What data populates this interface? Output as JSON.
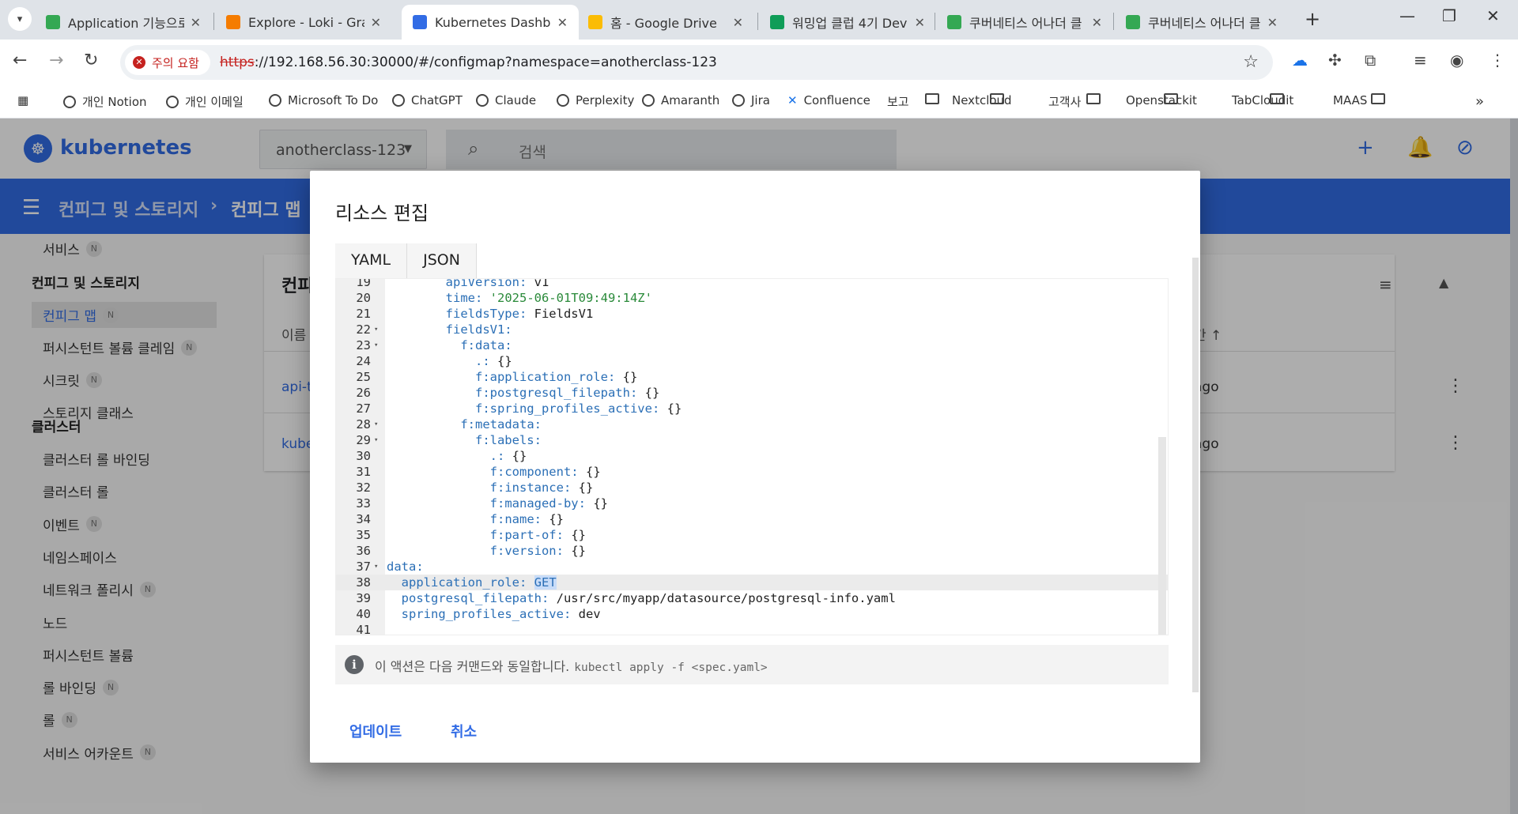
{
  "browser": {
    "tabs": [
      {
        "label": "Application 기능으로",
        "color": "#34a853"
      },
      {
        "label": "Explore - Loki - Graf",
        "color": "#f57c00"
      },
      {
        "label": "Kubernetes Dashboard",
        "color": "#326ce5"
      },
      {
        "label": "홈 - Google Drive",
        "color": "#fbbc04"
      },
      {
        "label": "워밍업 클럽 4기 Dev",
        "color": "#0f9d58"
      },
      {
        "label": "쿠버네티스 어나더 클",
        "color": "#34a853"
      },
      {
        "label": "쿠버네티스 어나더 클",
        "color": "#34a853"
      }
    ],
    "security_chip": "주의 요함",
    "url_scheme": "https",
    "url_rest": "://192.168.56.30:30000/#/configmap?namespace=anotherclass-123",
    "bookmarks": [
      {
        "label": "개인 Notion",
        "kind": "globe"
      },
      {
        "label": "개인 이메일",
        "kind": "globe"
      },
      {
        "label": "Microsoft To Do",
        "kind": "globe"
      },
      {
        "label": "ChatGPT",
        "kind": "globe"
      },
      {
        "label": "Claude",
        "kind": "globe"
      },
      {
        "label": "Perplexity",
        "kind": "globe"
      },
      {
        "label": "Amaranth",
        "kind": "globe"
      },
      {
        "label": "Jira",
        "kind": "globe"
      },
      {
        "label": "Confluence",
        "kind": "confluence"
      },
      {
        "label": "보고",
        "kind": "folder"
      },
      {
        "label": "Nextcloud",
        "kind": "folder"
      },
      {
        "label": "고객사",
        "kind": "folder"
      },
      {
        "label": "Openstackit",
        "kind": "folder"
      },
      {
        "label": "TabCloudit",
        "kind": "folder"
      },
      {
        "label": "MAAS",
        "kind": "folder"
      }
    ]
  },
  "app": {
    "brand": "kubernetes",
    "namespace": "anotherclass-123",
    "search_placeholder": "검색",
    "breadcrumb": [
      "컨피그 및 스토리지",
      "컨피그 맵"
    ],
    "sidebar": {
      "top_item": "서비스",
      "section_config": "컨피그 및 스토리지",
      "config_items": [
        {
          "label": "컨피그 맵",
          "badge": "N",
          "selected": true
        },
        {
          "label": "퍼시스턴트 볼륨 클레임",
          "badge": "N"
        },
        {
          "label": "시크릿",
          "badge": "N"
        },
        {
          "label": "스토리지 클래스",
          "badge": ""
        }
      ],
      "section_cluster": "클러스터",
      "cluster_items": [
        {
          "label": "클러스터 롤 바인딩",
          "badge": ""
        },
        {
          "label": "클러스터 롤",
          "badge": ""
        },
        {
          "label": "이벤트",
          "badge": "N"
        },
        {
          "label": "네임스페이스",
          "badge": ""
        },
        {
          "label": "네트워크 폴리시",
          "badge": "N"
        },
        {
          "label": "노드",
          "badge": ""
        },
        {
          "label": "퍼시스턴트 볼륨",
          "badge": ""
        },
        {
          "label": "롤 바인딩",
          "badge": "N"
        },
        {
          "label": "롤",
          "badge": "N"
        },
        {
          "label": "서비스 어카운트",
          "badge": "N"
        }
      ]
    },
    "card": {
      "title": "컨피",
      "col_name": "이름",
      "col_time": "간",
      "rows": [
        {
          "name": "api-te",
          "age": "ago"
        },
        {
          "name": "kube",
          "age": "ago"
        }
      ]
    }
  },
  "modal": {
    "title": "리소스 편집",
    "tabs": [
      "YAML",
      "JSON"
    ],
    "lines": [
      {
        "n": "19",
        "fold": false,
        "indent": "        ",
        "segments": [
          {
            "t": "apiVersion: ",
            "c": "k"
          },
          {
            "t": "v1",
            "c": "v"
          }
        ]
      },
      {
        "n": "20",
        "fold": false,
        "indent": "        ",
        "segments": [
          {
            "t": "time: ",
            "c": "k"
          },
          {
            "t": "'2025-06-01T09:49:14Z'",
            "c": "s"
          }
        ]
      },
      {
        "n": "21",
        "fold": false,
        "indent": "        ",
        "segments": [
          {
            "t": "fieldsType: ",
            "c": "k"
          },
          {
            "t": "FieldsV1",
            "c": "v"
          }
        ]
      },
      {
        "n": "22",
        "fold": true,
        "indent": "        ",
        "segments": [
          {
            "t": "fieldsV1:",
            "c": "k"
          }
        ]
      },
      {
        "n": "23",
        "fold": true,
        "indent": "          ",
        "segments": [
          {
            "t": "f:data:",
            "c": "k"
          }
        ]
      },
      {
        "n": "24",
        "fold": false,
        "indent": "            ",
        "segments": [
          {
            "t": ".: ",
            "c": "k"
          },
          {
            "t": "{}",
            "c": "v"
          }
        ]
      },
      {
        "n": "25",
        "fold": false,
        "indent": "            ",
        "segments": [
          {
            "t": "f:application_role: ",
            "c": "k"
          },
          {
            "t": "{}",
            "c": "v"
          }
        ]
      },
      {
        "n": "26",
        "fold": false,
        "indent": "            ",
        "segments": [
          {
            "t": "f:postgresql_filepath: ",
            "c": "k"
          },
          {
            "t": "{}",
            "c": "v"
          }
        ]
      },
      {
        "n": "27",
        "fold": false,
        "indent": "            ",
        "segments": [
          {
            "t": "f:spring_profiles_active: ",
            "c": "k"
          },
          {
            "t": "{}",
            "c": "v"
          }
        ]
      },
      {
        "n": "28",
        "fold": true,
        "indent": "          ",
        "segments": [
          {
            "t": "f:metadata:",
            "c": "k"
          }
        ]
      },
      {
        "n": "29",
        "fold": true,
        "indent": "            ",
        "segments": [
          {
            "t": "f:labels:",
            "c": "k"
          }
        ]
      },
      {
        "n": "30",
        "fold": false,
        "indent": "              ",
        "segments": [
          {
            "t": ".: ",
            "c": "k"
          },
          {
            "t": "{}",
            "c": "v"
          }
        ]
      },
      {
        "n": "31",
        "fold": false,
        "indent": "              ",
        "segments": [
          {
            "t": "f:component: ",
            "c": "k"
          },
          {
            "t": "{}",
            "c": "v"
          }
        ]
      },
      {
        "n": "32",
        "fold": false,
        "indent": "              ",
        "segments": [
          {
            "t": "f:instance: ",
            "c": "k"
          },
          {
            "t": "{}",
            "c": "v"
          }
        ]
      },
      {
        "n": "33",
        "fold": false,
        "indent": "              ",
        "segments": [
          {
            "t": "f:managed-by: ",
            "c": "k"
          },
          {
            "t": "{}",
            "c": "v"
          }
        ]
      },
      {
        "n": "34",
        "fold": false,
        "indent": "              ",
        "segments": [
          {
            "t": "f:name: ",
            "c": "k"
          },
          {
            "t": "{}",
            "c": "v"
          }
        ]
      },
      {
        "n": "35",
        "fold": false,
        "indent": "              ",
        "segments": [
          {
            "t": "f:part-of: ",
            "c": "k"
          },
          {
            "t": "{}",
            "c": "v"
          }
        ]
      },
      {
        "n": "36",
        "fold": false,
        "indent": "              ",
        "segments": [
          {
            "t": "f:version: ",
            "c": "k"
          },
          {
            "t": "{}",
            "c": "v"
          }
        ]
      },
      {
        "n": "37",
        "fold": true,
        "indent": "",
        "segments": [
          {
            "t": "data:",
            "c": "k"
          }
        ]
      },
      {
        "n": "38",
        "fold": false,
        "indent": "  ",
        "active": true,
        "segments": [
          {
            "t": "application_role: ",
            "c": "k"
          },
          {
            "t": "GET",
            "c": "sel"
          }
        ]
      },
      {
        "n": "39",
        "fold": false,
        "indent": "  ",
        "segments": [
          {
            "t": "postgresql_filepath: ",
            "c": "k"
          },
          {
            "t": "/usr/src/myapp/datasource/postgresql-info.yaml",
            "c": "v"
          }
        ]
      },
      {
        "n": "40",
        "fold": false,
        "indent": "  ",
        "segments": [
          {
            "t": "spring_profiles_active: ",
            "c": "k"
          },
          {
            "t": "dev",
            "c": "v"
          }
        ]
      },
      {
        "n": "41",
        "fold": false,
        "indent": "",
        "segments": []
      }
    ],
    "info_text": "이 액션은 다음 커맨드와 동일합니다.",
    "info_command": "kubectl apply -f <spec.yaml>",
    "update_label": "업데이트",
    "cancel_label": "취소"
  }
}
